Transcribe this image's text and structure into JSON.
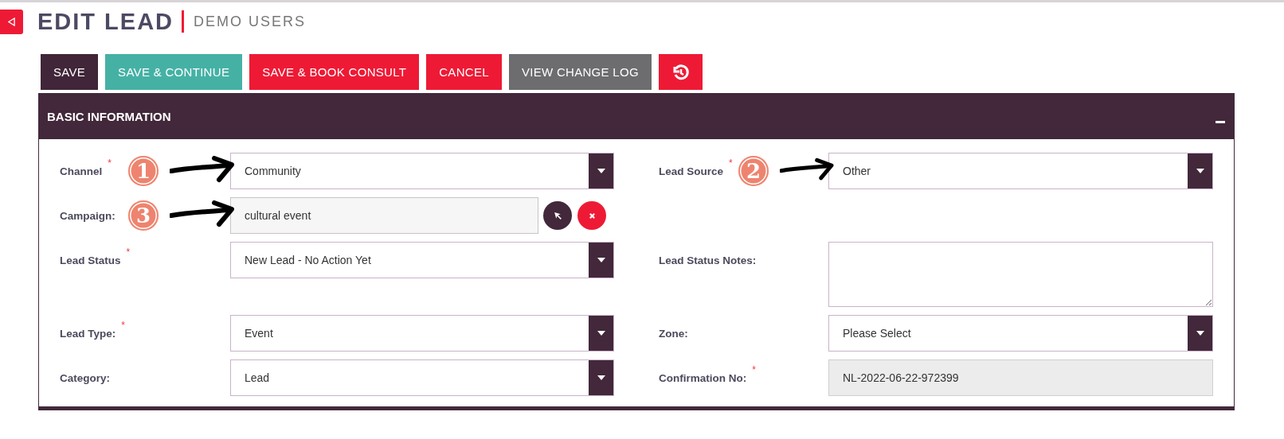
{
  "header": {
    "title": "EDIT LEAD",
    "subtitle": "DEMO USERS"
  },
  "buttons": [
    {
      "kind": "text",
      "label": "SAVE",
      "color": "#402638"
    },
    {
      "kind": "text",
      "label": "SAVE & CONTINUE",
      "color": "#45b1a5"
    },
    {
      "kind": "text",
      "label": "SAVE & BOOK CONSULT",
      "color": "#ee1a35"
    },
    {
      "kind": "text",
      "label": "CANCEL",
      "color": "#ee1a35"
    },
    {
      "kind": "text",
      "label": "VIEW CHANGE LOG",
      "color": "#6d6d70"
    },
    {
      "kind": "icon",
      "color": "#ee1a35"
    }
  ],
  "panel": {
    "title": "BASIC INFORMATION",
    "expanded": true,
    "rows": [
      {
        "left": {
          "label": "Channel",
          "asterisk": "*",
          "kind": "select",
          "value": "Community",
          "marker": "1"
        },
        "right": {
          "label": "Lead Source",
          "asterisk": "*",
          "kind": "select",
          "value": "Other",
          "marker": "2"
        }
      },
      {
        "left": {
          "label": "Campaign:",
          "kind": "lookup",
          "value": "cultural event",
          "marker": "3"
        }
      },
      {
        "left": {
          "label": "Lead Status",
          "asterisk": "*",
          "kind": "select",
          "value": "New Lead - No Action Yet"
        },
        "right": {
          "label": "Lead Status Notes:",
          "kind": "textarea"
        }
      },
      {
        "left": {
          "label": "Lead Type:",
          "asterisk": "*",
          "kind": "select",
          "value": "Event"
        },
        "right": {
          "label": "Zone:",
          "kind": "select",
          "value": "Please Select"
        }
      },
      {
        "left": {
          "label": "Category:",
          "kind": "select",
          "value": "Lead"
        },
        "right": {
          "label": "Confirmation No:",
          "asterisk": "*",
          "kind": "readonly",
          "value": "NL-2022-06-22-972399"
        }
      }
    ]
  }
}
